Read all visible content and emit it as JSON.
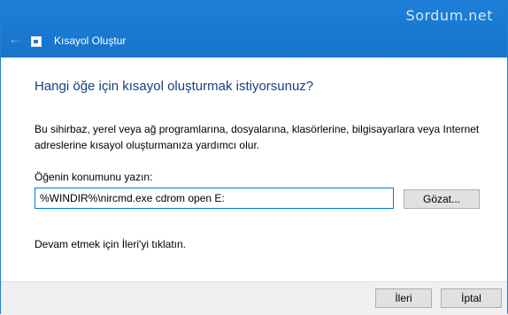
{
  "window": {
    "title": "Kısayol Oluştur",
    "watermark": "Sordum.net"
  },
  "main": {
    "heading": "Hangi öğe için kısayol oluşturmak istiyorsunuz?",
    "description": "Bu sihirbaz, yerel veya ağ programlarına, dosyalarına, klasörlerine, bilgisayarlara veya Internet adreslerine kısayol oluşturmanıza yardımcı olur.",
    "field_label": "Öğenin konumunu yazın:",
    "path_value": "%WINDIR%\\nircmd.exe cdrom open E:",
    "browse_label": "Gözat...",
    "hint": "Devam etmek için İleri'yi tıklatın."
  },
  "footer": {
    "next_label": "İleri",
    "cancel_label": "İptal"
  },
  "colors": {
    "titlebar": "#1874c9",
    "heading": "#143f8a",
    "input_border": "#0078d7"
  },
  "icons": {
    "back": "back-arrow-icon",
    "app": "shortcut-wizard-icon"
  }
}
